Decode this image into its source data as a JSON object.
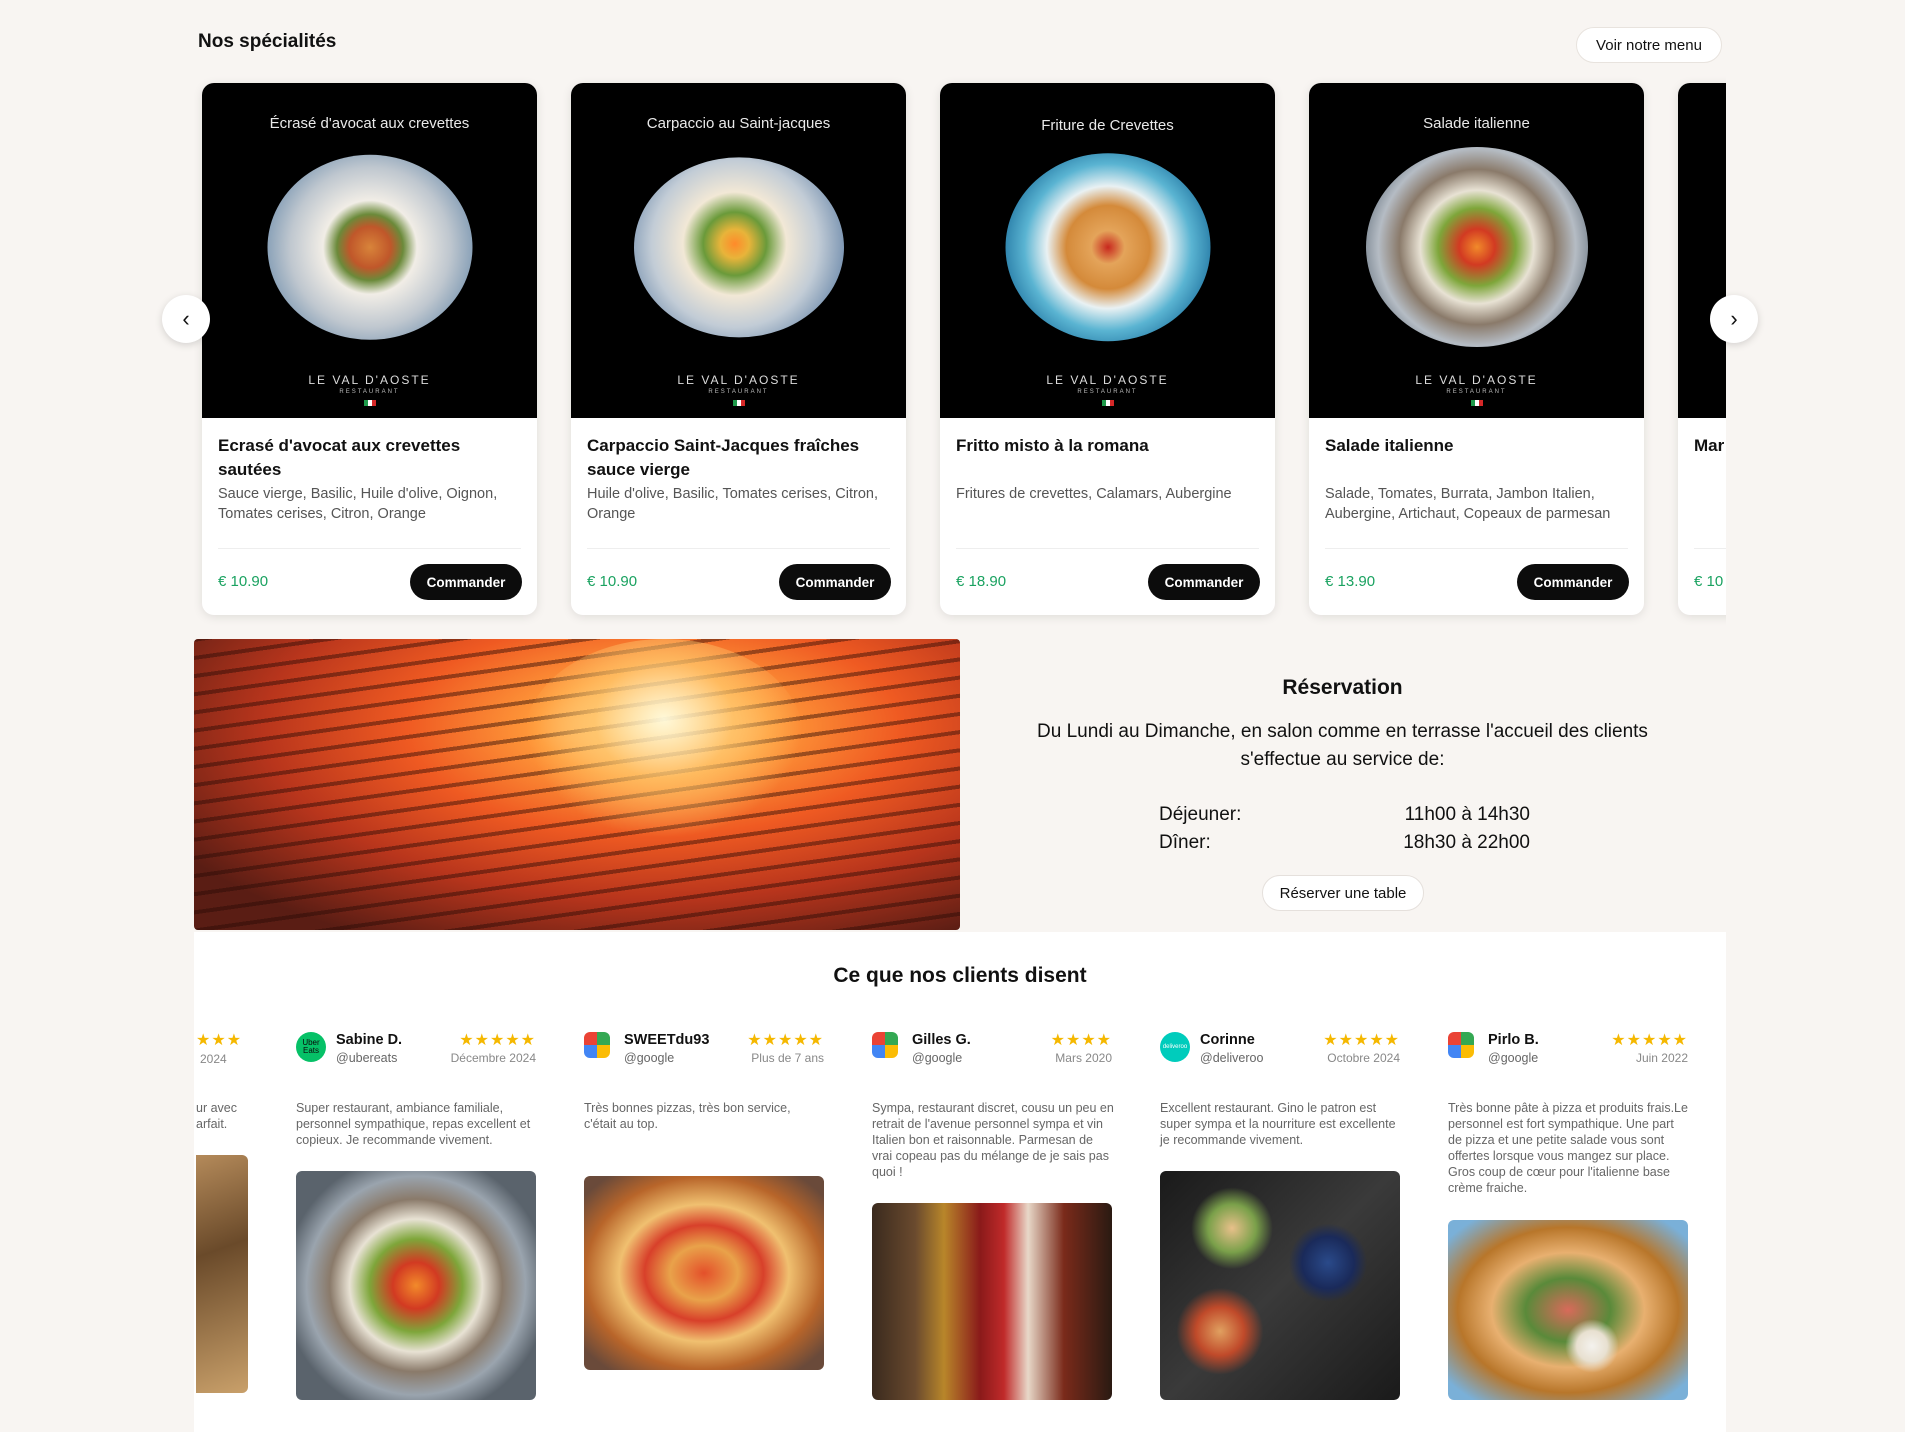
{
  "specialties": {
    "title": "Nos spécialités",
    "menu_button": "Voir notre menu",
    "prev_label": "‹",
    "next_label": "›",
    "cards": [
      {
        "caption": "Écrasé d'avocat aux crevettes",
        "brand": "LE VAL D'AOSTE",
        "brand_sub": "RESTAURANT",
        "title": "Ecrasé d'avocat aux crevettes sautées",
        "desc": "Sauce vierge, Basilic, Huile d'olive, Oignon, Tomates cerises, Citron, Orange",
        "price": "€  10.90",
        "order": "Commander"
      },
      {
        "caption": "Carpaccio au Saint-jacques",
        "brand": "LE VAL D'AOSTE",
        "brand_sub": "RESTAURANT",
        "title": "Carpaccio Saint-Jacques fraîches sauce vierge",
        "desc": "Huile d'olive, Basilic, Tomates cerises, Citron, Orange",
        "price": "€  10.90",
        "order": "Commander"
      },
      {
        "caption": "Friture de Crevettes",
        "brand": "LE VAL D'AOSTE",
        "brand_sub": "RESTAURANT",
        "title": "Fritto misto à la romana",
        "desc": "Fritures de crevettes, Calamars, Aubergine",
        "price": "€  18.90",
        "order": "Commander"
      },
      {
        "caption": "Salade italienne",
        "brand": "LE VAL D'AOSTE",
        "brand_sub": "RESTAURANT",
        "title": "Salade italienne",
        "desc": "Salade, Tomates, Burrata, Jambon Italien, Aubergine, Artichaut, Copeaux de parmesan",
        "price": "€  13.90",
        "order": "Commander"
      },
      {
        "caption": "",
        "brand": "",
        "brand_sub": "",
        "title": "Mar",
        "desc": "",
        "price": "€  10",
        "order": ""
      }
    ]
  },
  "reservation": {
    "title": "Réservation",
    "text": "Du Lundi au Dimanche, en salon comme en terrasse l'accueil des clients s'effectue au service de:",
    "hours": [
      {
        "label": "Déjeuner:",
        "value": "11h00 à 14h30"
      },
      {
        "label": "Dîner:",
        "value": "18h30 à 22h00"
      }
    ],
    "button": "Réserver une table"
  },
  "reviews": {
    "title": "Ce que nos clients disent",
    "partial": {
      "stars": "★★★",
      "date": "2024",
      "text": "ur avec\narfait."
    },
    "items": [
      {
        "name": "Sabine D.",
        "handle": "@ubereats",
        "stars": "★★★★★",
        "date": "Décembre 2024",
        "text": "Super restaurant, ambiance familiale, personnel sympathique, repas excellent et copieux. Je recommande vivement.",
        "avatar_label": "Uber Eats"
      },
      {
        "name": "SWEETdu93",
        "handle": "@google",
        "stars": "★★★★★",
        "date": "Plus de 7 ans",
        "text": "Très bonnes pizzas, très bon service, c'était au top.",
        "avatar_label": ""
      },
      {
        "name": "Gilles G.",
        "handle": "@google",
        "stars": "★★★★",
        "date": "Mars 2020",
        "text": "Sympa, restaurant discret, cousu un peu en retrait de l'avenue personnel sympa et vin Italien bon et raisonnable. Parmesan de vrai copeau pas du mélange de je sais pas quoi !",
        "avatar_label": ""
      },
      {
        "name": "Corinne",
        "handle": "@deliveroo",
        "stars": "★★★★★",
        "date": "Octobre 2024",
        "text": "Excellent restaurant. Gino le patron est super sympa et la nourriture est excellente je recommande vivement.",
        "avatar_label": "deliveroo"
      },
      {
        "name": "Pirlo B.",
        "handle": "@google",
        "stars": "★★★★★",
        "date": "Juin 2022",
        "text": "Très bonne pâte à pizza et produits frais.Le personnel est fort sympathique. Une part de pizza et une petite salade vous sont offertes lorsque vous mangez sur place. Gros coup de cœur pour l'italienne base crème fraiche.",
        "avatar_label": ""
      }
    ]
  }
}
